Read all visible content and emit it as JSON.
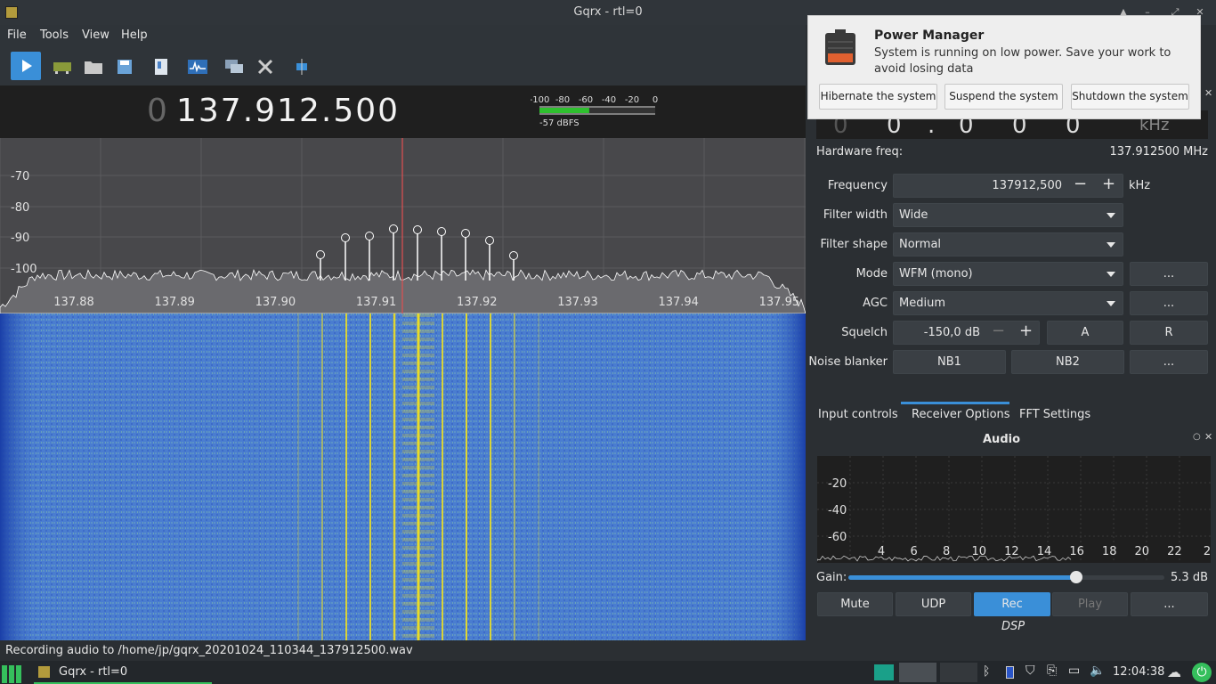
{
  "window": {
    "title": "Gqrx - rtl=0"
  },
  "menu": [
    "File",
    "Tools",
    "View",
    "Help"
  ],
  "toolbar": {
    "icons": [
      "play-icon",
      "device-icon",
      "folder-icon",
      "save-icon",
      "bookmark-icon",
      "spectrum-icon",
      "remote-icon",
      "tools-icon",
      "fullscreen-icon"
    ]
  },
  "frequency": {
    "prefix": "0",
    "value": "137.912.500"
  },
  "meter": {
    "ticks": [
      "-100",
      "-80",
      "-60",
      "-40",
      "-20",
      "0"
    ],
    "reading": "-57 dBFS",
    "level": 0.43
  },
  "spectrum": {
    "yticks": [
      "-70",
      "-80",
      "-90",
      "-100"
    ],
    "xticks": [
      "137.88",
      "137.89",
      "137.90",
      "137.91",
      "137.92",
      "137.93",
      "137.94",
      "137.95"
    ]
  },
  "status": {
    "text": "Recording audio to /home/jp/gqrx_20201024_110344_137912500.wav"
  },
  "lnb": {
    "digits": [
      "0",
      "0",
      ".",
      "0",
      "0",
      "0"
    ],
    "unit": "kHz"
  },
  "hardware": {
    "label": "Hardware freq:",
    "value": "137.912500 MHz"
  },
  "receiver": {
    "frequency_label": "Frequency",
    "frequency_value": "137912,500",
    "frequency_unit": "kHz",
    "filter_width_label": "Filter width",
    "filter_width": "Wide",
    "filter_shape_label": "Filter shape",
    "filter_shape": "Normal",
    "mode_label": "Mode",
    "mode": "WFM (mono)",
    "agc_label": "AGC",
    "agc": "Medium",
    "squelch_label": "Squelch",
    "squelch": "-150,0 dB",
    "squelch_a": "A",
    "squelch_r": "R",
    "nb_label": "Noise blanker",
    "nb1": "NB1",
    "nb2": "NB2",
    "more": "..."
  },
  "tabs": [
    "Input controls",
    "Receiver Options",
    "FFT Settings"
  ],
  "audio": {
    "title": "Audio",
    "yticks": [
      "-20",
      "-40",
      "-60"
    ],
    "xticks": [
      "4",
      "6",
      "8",
      "10",
      "12",
      "14",
      "16",
      "18",
      "20",
      "22",
      "2"
    ],
    "gain_label": "Gain:",
    "gain_value": "5.3 dB",
    "gain_fraction": 0.72,
    "buttons": [
      "Mute",
      "UDP",
      "Rec",
      "Play",
      "..."
    ],
    "dsp": "DSP"
  },
  "notification": {
    "title": "Power Manager",
    "body": "System is running on low power. Save your work to avoid losing data",
    "buttons": [
      "Hibernate the system",
      "Suspend the system",
      "Shutdown the system"
    ]
  },
  "taskbar": {
    "app": "Gqrx - rtl=0",
    "time": "12:04:38"
  },
  "colors": {
    "accent": "#3a8fd8",
    "waterfall": "#3f70c8",
    "signal": "#f0e020",
    "cursor": "#e05050"
  }
}
